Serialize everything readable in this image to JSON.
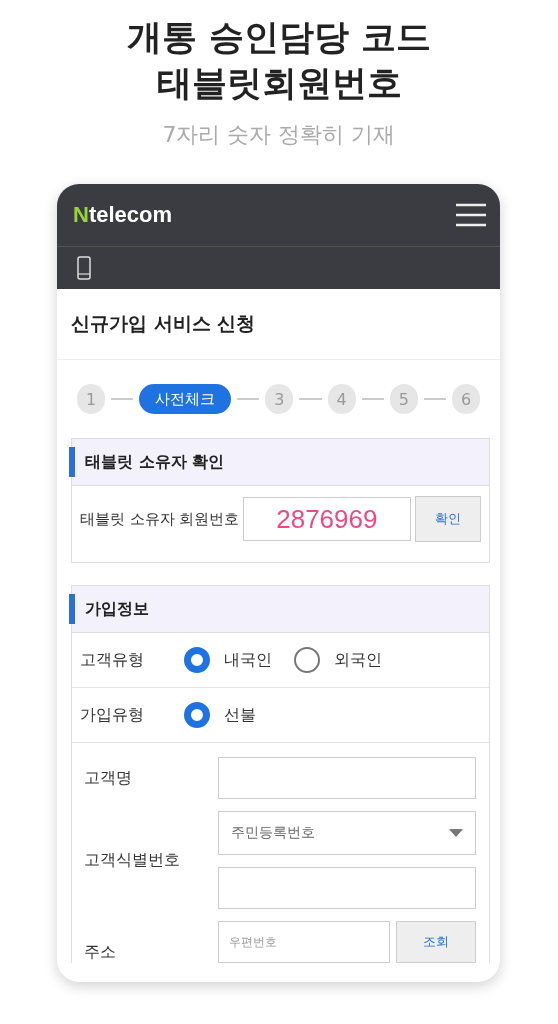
{
  "headline": {
    "lines": [
      "개통 승인담당 코드",
      "태블릿회원번호"
    ],
    "subtitle": "7자리 숫자 정확히 기재"
  },
  "app": {
    "logo_mark": "N",
    "logo_text": "telecom",
    "page_title": "신규가입 서비스 신청",
    "steps": [
      {
        "label": "1",
        "selected": false
      },
      {
        "label": "사전체크",
        "selected": true
      },
      {
        "label": "3",
        "selected": false
      },
      {
        "label": "4",
        "selected": false
      },
      {
        "label": "5",
        "selected": false
      },
      {
        "label": "6",
        "selected": false
      }
    ],
    "owner_section": {
      "title": "태블릿 소유자 확인",
      "field_label": "태블릿 소유자 회원번호",
      "value": "2876969",
      "button": "확인"
    },
    "join_section": {
      "title": "가입정보",
      "radio_rows": [
        {
          "label": "고객유형",
          "options": [
            {
              "label": "내국인",
              "selected": true
            },
            {
              "label": "외국인",
              "selected": false
            }
          ]
        },
        {
          "label": "가입유형",
          "options": [
            {
              "label": "선불",
              "selected": true
            }
          ]
        }
      ],
      "name_label": "고객명",
      "id_label": "고객식별번호",
      "id_type": "주민등록번호",
      "address_label": "주소",
      "zip_placeholder": "우편번호",
      "lookup_button": "조회"
    }
  }
}
